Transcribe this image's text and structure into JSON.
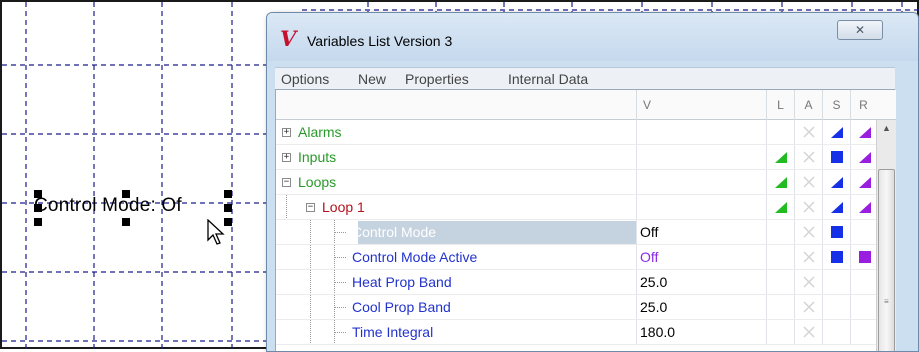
{
  "canvas": {
    "label_text": "Control Mode: Off",
    "label_visible": "Control Mode: Of"
  },
  "window": {
    "title": "Variables List Version 3",
    "logo_glyph": "V",
    "close_glyph": "✕"
  },
  "menu": {
    "items": [
      "Options",
      "New",
      "Properties",
      "Internal Data"
    ]
  },
  "columns": {
    "value": "V",
    "flags": [
      "L",
      "A",
      "S",
      "R"
    ]
  },
  "rows": [
    {
      "name": "Alarms",
      "value": "",
      "expander": "+",
      "color": "#2a9a2a",
      "indent": 0
    },
    {
      "name": "Inputs",
      "value": "",
      "expander": "+",
      "color": "#2a9a2a",
      "indent": 0
    },
    {
      "name": "Loops",
      "value": "",
      "expander": "−",
      "color": "#2a9a2a",
      "indent": 0
    },
    {
      "name": "Loop 1",
      "value": "",
      "expander": "−",
      "color": "#b3121e",
      "indent": 1
    },
    {
      "name": "Control Mode",
      "value": "Off",
      "color": "#ffffff",
      "indent": 2,
      "selected": true
    },
    {
      "name": "Control Mode Active",
      "value": "Off",
      "color": "#2233cc",
      "value_color": "#8a2be2",
      "indent": 2
    },
    {
      "name": "Heat Prop Band",
      "value": "25.0",
      "color": "#2233cc",
      "indent": 2
    },
    {
      "name": "Cool Prop Band",
      "value": "25.0",
      "color": "#2233cc",
      "indent": 2
    },
    {
      "name": "Time Integral",
      "value": "180.0",
      "color": "#2233cc",
      "indent": 2
    }
  ],
  "colors": {
    "green_flag": "#22bb22",
    "blue_flag": "#1530e6",
    "purple_flag": "#9a1ee0",
    "disabled_x": "#d4d4d4"
  }
}
